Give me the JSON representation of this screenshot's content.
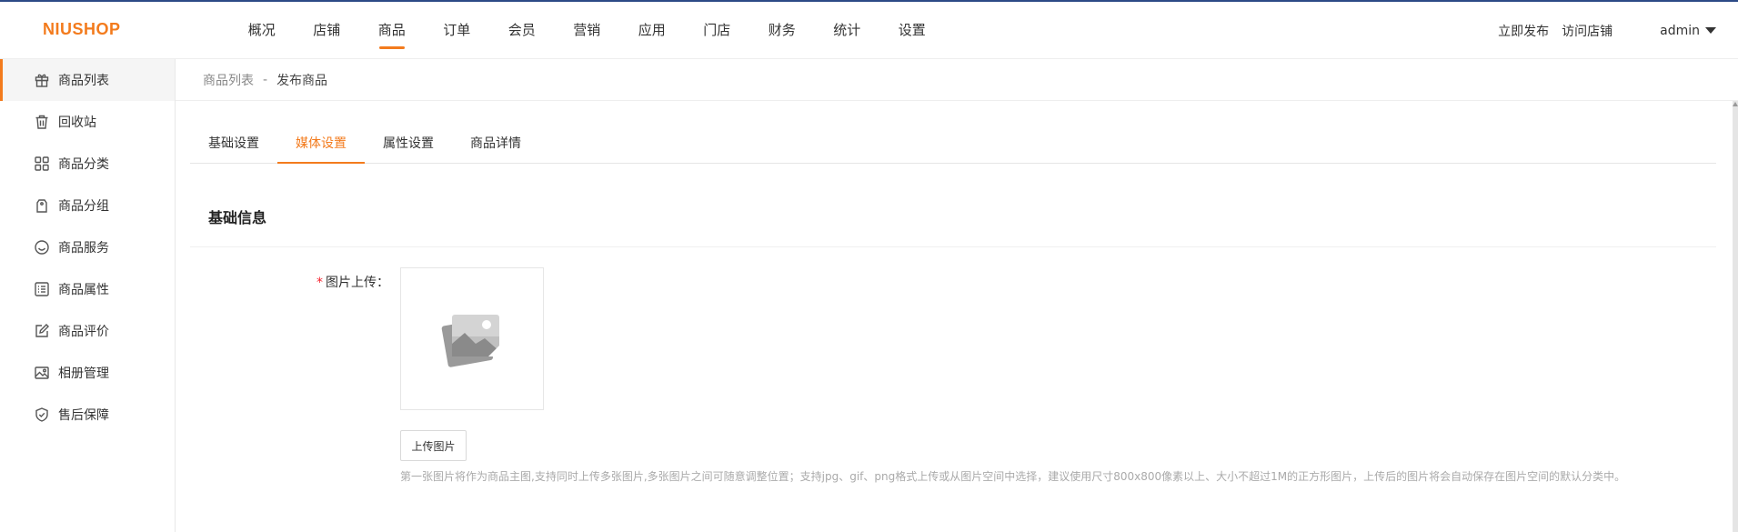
{
  "header": {
    "logo": "NIUSHOP",
    "nav": [
      "概况",
      "店铺",
      "商品",
      "订单",
      "会员",
      "营销",
      "应用",
      "门店",
      "财务",
      "统计",
      "设置"
    ],
    "active_nav": "商品",
    "publish": "立即发布",
    "visit_store": "访问店铺",
    "user": "admin"
  },
  "sidebar": {
    "items": [
      {
        "label": "商品列表",
        "icon": "gift-icon"
      },
      {
        "label": "回收站",
        "icon": "trash-icon"
      },
      {
        "label": "商品分类",
        "icon": "grid-icon"
      },
      {
        "label": "商品分组",
        "icon": "tag-icon"
      },
      {
        "label": "商品服务",
        "icon": "smile-icon"
      },
      {
        "label": "商品属性",
        "icon": "list-icon"
      },
      {
        "label": "商品评价",
        "icon": "edit-icon"
      },
      {
        "label": "相册管理",
        "icon": "image-icon"
      },
      {
        "label": "售后保障",
        "icon": "shield-icon"
      }
    ],
    "active": "商品列表"
  },
  "breadcrumb": {
    "parent": "商品列表",
    "separator": "-",
    "current": "发布商品"
  },
  "tabs": [
    "基础设置",
    "媒体设置",
    "属性设置",
    "商品详情"
  ],
  "active_tab": "媒体设置",
  "section": {
    "title": "基础信息"
  },
  "form": {
    "required_mark": "*",
    "image_label": "图片上传：",
    "upload_button": "上传图片",
    "hint": "第一张图片将作为商品主图,支持同时上传多张图片,多张图片之间可随意调整位置；支持jpg、gif、png格式上传或从图片空间中选择，建议使用尺寸800x800像素以上、大小不超过1M的正方形图片，上传后的图片将会自动保存在图片空间的默认分类中。"
  },
  "colors": {
    "accent": "#f37b1d",
    "top_line": "#2c4a86"
  }
}
